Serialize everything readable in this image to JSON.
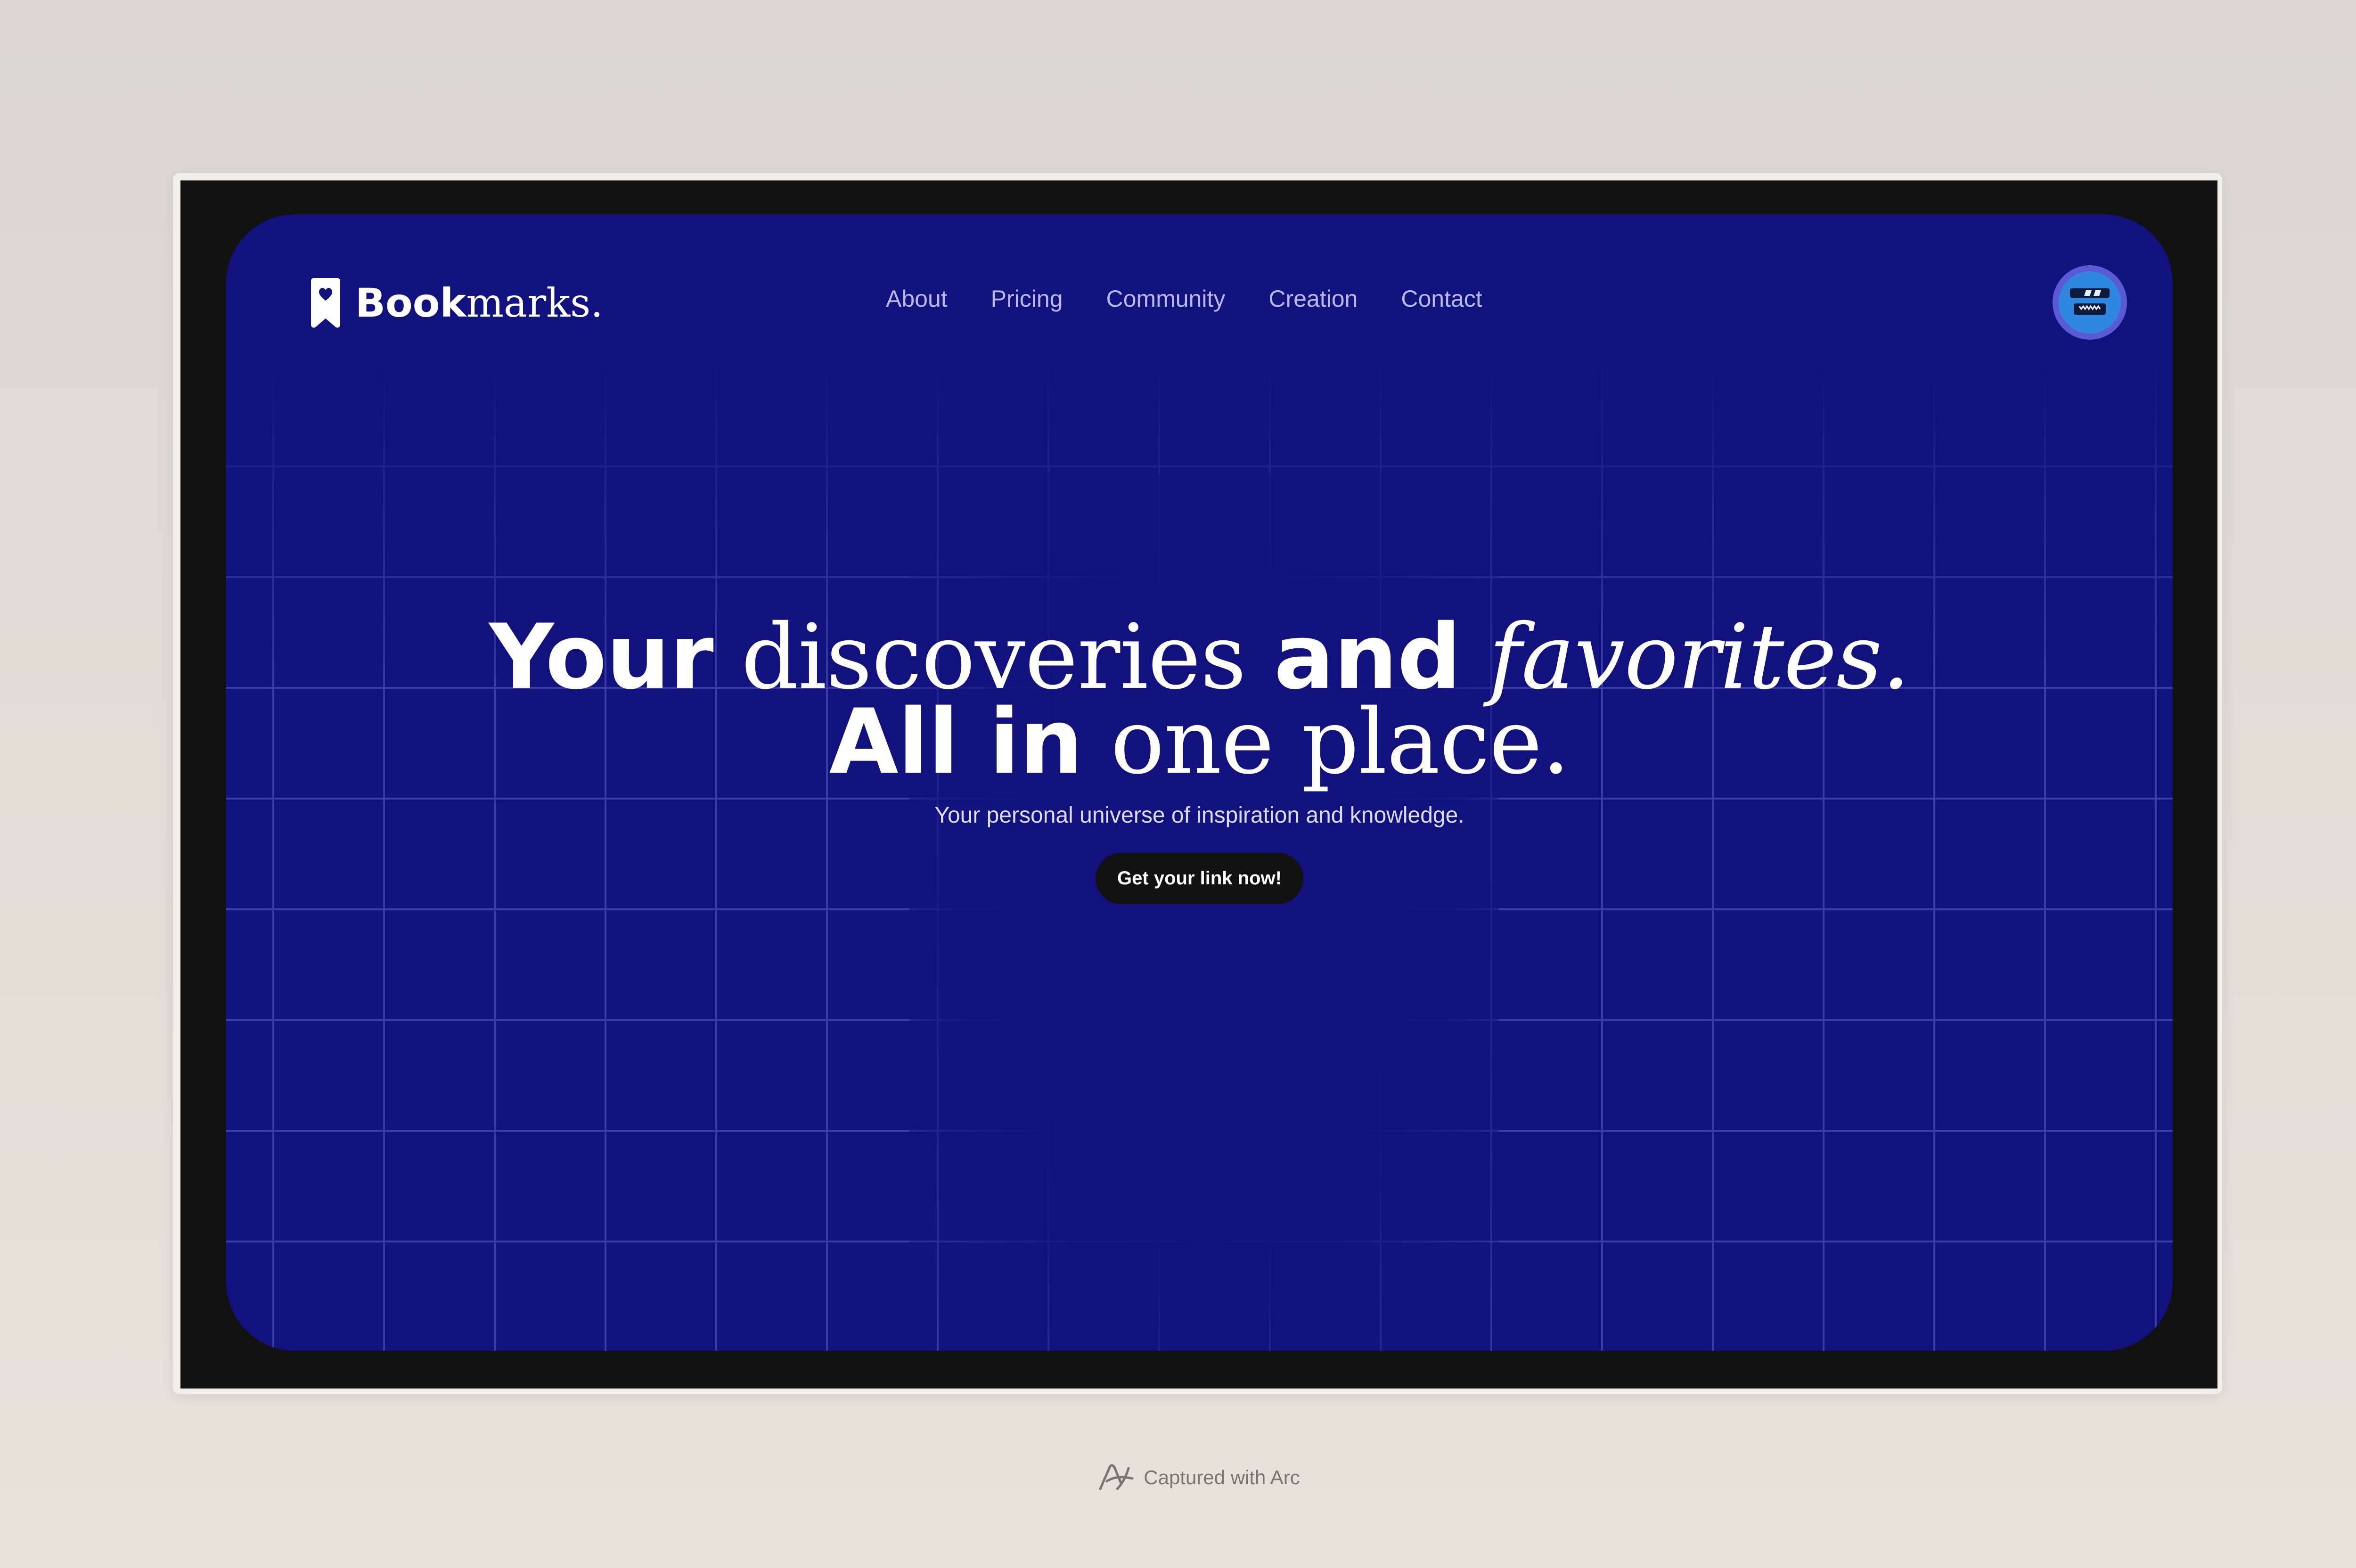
{
  "brand": {
    "name_bold": "Book",
    "name_serif": "marks.",
    "icon": "bookmark-heart-icon"
  },
  "nav": {
    "items": [
      {
        "label": "About"
      },
      {
        "label": "Pricing"
      },
      {
        "label": "Community"
      },
      {
        "label": "Creation"
      },
      {
        "label": "Contact"
      }
    ]
  },
  "user": {
    "avatar_icon": "robot-avatar-icon"
  },
  "hero": {
    "line1": [
      {
        "text": "Your",
        "style": "bold"
      },
      {
        "text": " discoveries ",
        "style": "serif"
      },
      {
        "text": "and",
        "style": "bold"
      },
      {
        "text": " favorites.",
        "style": "serif-italic"
      }
    ],
    "line2": [
      {
        "text": "All in",
        "style": "bold"
      },
      {
        "text": " one place.",
        "style": "serif"
      }
    ],
    "subtitle": "Your personal universe of inspiration and knowledge.",
    "cta_label": "Get your link now!"
  },
  "footer": {
    "text": "Captured with Arc",
    "icon": "arc-logo-icon"
  },
  "colors": {
    "page_background": "#dfd9d2",
    "window_frame": "#111111",
    "site_background": "#12127f",
    "grid_line": "#3a3aa8",
    "nav_text": "#b9b8e8",
    "cta_background": "#111111",
    "avatar_ring": "#5a5ad6",
    "avatar_fill": "#2f87e0"
  }
}
